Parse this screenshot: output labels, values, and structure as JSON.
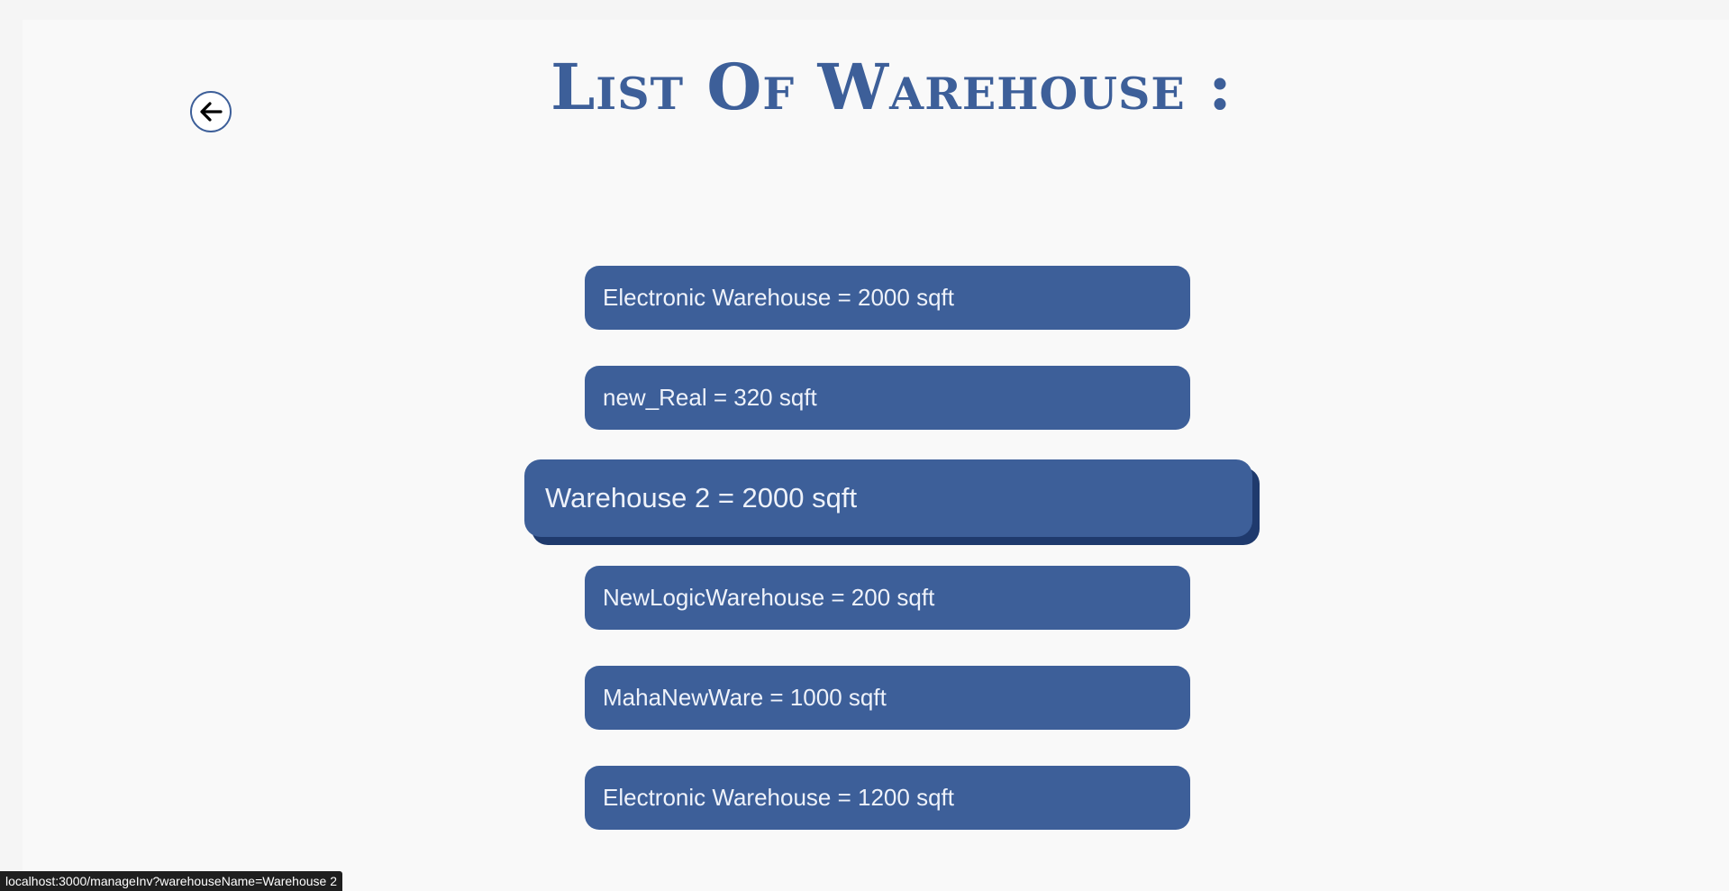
{
  "header": {
    "title": "List Of Warehouse :",
    "back_icon": "arrow-left-icon"
  },
  "warehouses": [
    {
      "label": "Electronic Warehouse = 2000 sqft",
      "name": "Electronic Warehouse",
      "area_sqft": 2000,
      "hovered": false
    },
    {
      "label": "new_Real = 320 sqft",
      "name": "new_Real",
      "area_sqft": 320,
      "hovered": false
    },
    {
      "label": "Warehouse 2 = 2000 sqft",
      "name": "Warehouse 2",
      "area_sqft": 2000,
      "hovered": true
    },
    {
      "label": "NewLogicWarehouse = 200 sqft",
      "name": "NewLogicWarehouse",
      "area_sqft": 200,
      "hovered": false
    },
    {
      "label": "MahaNewWare = 1000 sqft",
      "name": "MahaNewWare",
      "area_sqft": 1000,
      "hovered": false
    },
    {
      "label": "Electronic Warehouse = 1200 sqft",
      "name": "Electronic Warehouse",
      "area_sqft": 1200,
      "hovered": false
    }
  ],
  "status_bar": {
    "url": "localhost:3000/manageInv?warehouseName=Warehouse 2"
  },
  "colors": {
    "accent": "#3d5f99",
    "accent_shadow": "#1f3a6d",
    "background": "#f9f9f9",
    "item_text": "#eef2fa"
  }
}
